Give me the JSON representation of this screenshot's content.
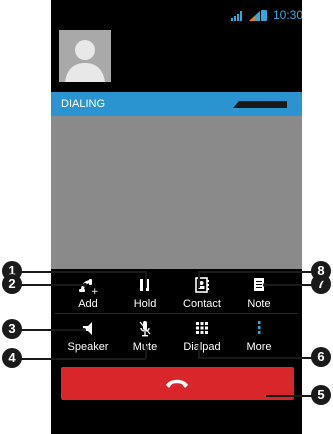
{
  "status_bar": {
    "time": "10:30",
    "icons": [
      "wifi-signal-icon",
      "cellular-signal-icon",
      "battery-icon"
    ],
    "accent": "#2fa8dd"
  },
  "call": {
    "state": "DIALING",
    "state_bar_color": "#2994cf",
    "avatar_icon": "contact-silhouette-icon"
  },
  "controls": {
    "row1": [
      {
        "label": "Add",
        "icon": "add-call-icon"
      },
      {
        "label": "Hold",
        "icon": "pause-icon"
      },
      {
        "label": "Contact",
        "icon": "contact-card-icon"
      },
      {
        "label": "Note",
        "icon": "note-icon"
      }
    ],
    "row2": [
      {
        "label": "Speaker",
        "icon": "speaker-icon"
      },
      {
        "label": "Mute",
        "icon": "microphone-mute-icon"
      },
      {
        "label": "Dialpad",
        "icon": "dialpad-icon"
      },
      {
        "label": "More",
        "icon": "more-vertical-icon"
      }
    ]
  },
  "end_call": {
    "icon": "end-call-icon",
    "color": "#d8262b"
  },
  "callouts": [
    "1",
    "2",
    "3",
    "4",
    "5",
    "6",
    "7",
    "8"
  ]
}
